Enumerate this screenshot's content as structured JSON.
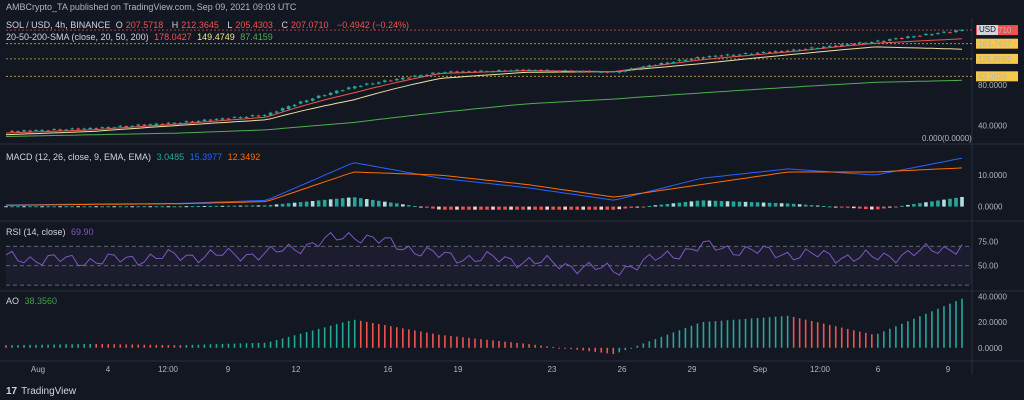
{
  "header": {
    "text": "AMBCrypto_TA published on TradingView.com, Sep 09, 2021 09:03 UTC"
  },
  "price_legend": {
    "symbol": "SOL / USD, 4h, BINANCE",
    "o_label": "O",
    "o": "207.5718",
    "h_label": "H",
    "h": "212.3645",
    "l_label": "L",
    "l": "205.4303",
    "c_label": "C",
    "c": "207.0710",
    "chg": "−0.4942 (−0.24%)"
  },
  "sma_legend": {
    "label": "20-50-200-SMA (close, 20, 50, 200)",
    "v20": "178.0427",
    "v50": "149.4749",
    "v200": "87.4159"
  },
  "macd_legend": {
    "label": "MACD (12, 26, close, 9, EMA, EMA)",
    "hist": "3.0485",
    "macd": "15.3977",
    "signal": "12.3492"
  },
  "rsi_legend": {
    "label": "RSI (14, close)",
    "value": "69.90"
  },
  "ao_legend": {
    "label": "AO",
    "value": "38.3560"
  },
  "price_axis": {
    "currency": "USD",
    "ticks": [
      "80.0000",
      "40.0000"
    ],
    "overlap_label": "0.000(0.0000)",
    "levels": [
      {
        "value": "207.0710",
        "bg": "#ef5350",
        "fg": "#ffffff"
      },
      {
        "value": "163.7437",
        "bg": "#f7c94a",
        "fg": "#131722"
      },
      {
        "value": "125.9592",
        "bg": "#f7c94a",
        "fg": "#131722"
      },
      {
        "value": "93.2030",
        "bg": "#f7c94a",
        "fg": "#131722"
      }
    ]
  },
  "macd_axis": {
    "ticks": [
      "10.0000",
      "0.0000"
    ]
  },
  "rsi_axis": {
    "ticks": [
      "75.00",
      "50.00"
    ]
  },
  "ao_axis": {
    "ticks": [
      "40.0000",
      "20.0000",
      "0.0000"
    ]
  },
  "time_axis": [
    "Aug",
    "4",
    "12:00",
    "9",
    "12",
    "16",
    "19",
    "23",
    "26",
    "29",
    "Sep",
    "12:00",
    "6",
    "9"
  ],
  "brand": "TradingView",
  "colors": {
    "bg": "#131722",
    "up": "#26a69a",
    "down": "#ef5350",
    "sma20": "#ef5350",
    "sma50": "#f0e0a0",
    "sma200": "#4caf50",
    "macd": "#2962ff",
    "signal": "#ff6d00",
    "rsi": "#7e57c2",
    "level": "#f7c94a"
  },
  "chart_data": {
    "type": "line",
    "title": "SOL / USD, 4h, BINANCE",
    "price": {
      "x": [
        "Aug",
        "4",
        "9",
        "12",
        "16",
        "19",
        "23",
        "26",
        "29",
        "Sep",
        "6",
        "9"
      ],
      "close": [
        36,
        38,
        42,
        48,
        78,
        100,
        104,
        100,
        130,
        145,
        170,
        207
      ]
    },
    "sma20": [
      35,
      37,
      41,
      46,
      70,
      98,
      103,
      101,
      124,
      142,
      165,
      178
    ],
    "sma50": [
      34,
      36,
      40,
      44,
      62,
      90,
      100,
      101,
      116,
      135,
      155,
      149
    ],
    "sma200": [
      33,
      34,
      35,
      37,
      42,
      50,
      58,
      63,
      70,
      77,
      84,
      87
    ],
    "macd": {
      "macd": [
        0.5,
        0.8,
        1,
        2,
        14,
        9,
        6,
        2,
        9,
        12,
        10,
        15.4
      ],
      "signal": [
        0.4,
        0.7,
        0.9,
        1.6,
        11,
        10,
        7,
        3,
        7,
        11,
        11,
        12.3
      ],
      "hist": [
        0.1,
        0.1,
        0.1,
        0.4,
        3,
        -1,
        -1,
        -1,
        2,
        1,
        -1,
        3.05
      ]
    },
    "rsi": [
      58,
      55,
      60,
      62,
      82,
      60,
      55,
      45,
      70,
      62,
      58,
      69.9
    ],
    "ao": [
      2,
      3,
      2,
      4,
      22,
      10,
      3,
      -5,
      20,
      25,
      10,
      38.36
    ]
  }
}
